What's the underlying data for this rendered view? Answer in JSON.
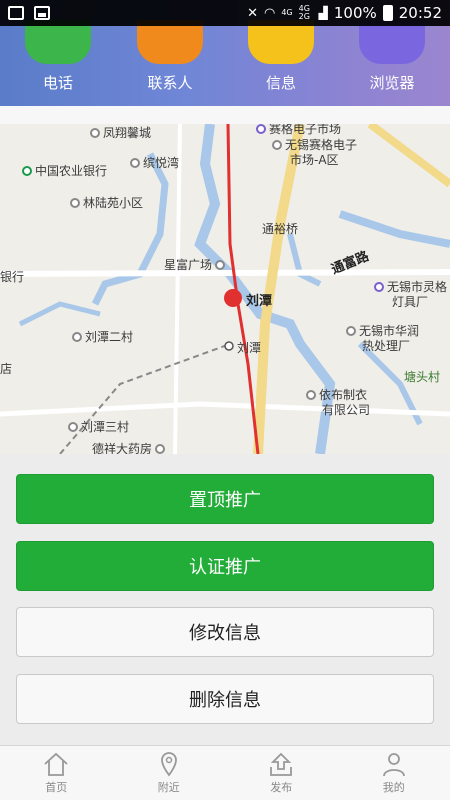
{
  "status_bar": {
    "network": "4G",
    "network2": "4G 2G",
    "battery": "100%",
    "time": "20:52"
  },
  "dock": [
    {
      "label": "电话",
      "icon": "phone-icon",
      "color": "#3cb54a"
    },
    {
      "label": "联系人",
      "icon": "contacts-icon",
      "color": "#f08a1c"
    },
    {
      "label": "信息",
      "icon": "message-icon",
      "color": "#f4c21a"
    },
    {
      "label": "浏览器",
      "icon": "browser-icon",
      "color": "#7a67e0"
    }
  ],
  "map": {
    "labels": {
      "fengxiang": "凤翔馨城",
      "abc_bank": "中国农业银行",
      "binyuewan": "缤悦湾",
      "linluyuan": "林陆苑小区",
      "saige_top": "赛格电子市场",
      "saige_a": "无锡赛格电子",
      "saige_a2": "市场-A区",
      "tongyuqiao": "通裕桥",
      "tongfulu": "通富路",
      "xingfu": "星富广场",
      "liutan_station": "刘潭",
      "liutan_stop": "刘潭",
      "bank_edge": "银行",
      "shop_edge": "店",
      "liutan_2": "刘潭二村",
      "liutan_3": "刘潭三村",
      "dexiang": "德祥大药房",
      "lingge_1": "无锡市灵格",
      "lingge_2": "灯具厂",
      "huarun_1": "无锡市华润",
      "huarun_2": "热处理厂",
      "tangtou": "塘头村",
      "yibu_1": "依布制衣",
      "yibu_2": "有限公司"
    }
  },
  "buttons": {
    "top_promote": "置顶推广",
    "certify_promote": "认证推广",
    "edit_info": "修改信息",
    "delete_info": "删除信息"
  },
  "nav": [
    {
      "label": "首页",
      "icon": "home-icon"
    },
    {
      "label": "附近",
      "icon": "location-pin-icon"
    },
    {
      "label": "发布",
      "icon": "publish-icon"
    },
    {
      "label": "我的",
      "icon": "user-icon"
    }
  ],
  "colors": {
    "accent_green": "#22ac38",
    "metro_red": "#e03030"
  }
}
